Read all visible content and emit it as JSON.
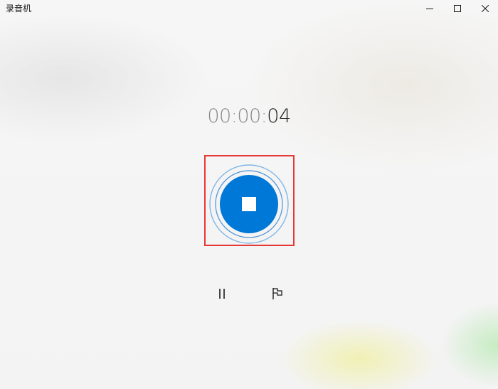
{
  "window": {
    "title": "录音机"
  },
  "titlebar": {
    "minimize_icon": "minimize-icon",
    "maximize_icon": "maximize-icon",
    "close_icon": "close-icon"
  },
  "timer": {
    "hours": "00",
    "sep1": ":",
    "minutes": "00",
    "sep2": ":",
    "seconds": "04"
  },
  "controls": {
    "stop_icon": "stop-icon",
    "pause_icon": "pause-icon",
    "flag_icon": "flag-icon"
  },
  "colors": {
    "accent": "#0078d7",
    "ring": "#7fb6e6",
    "highlight": "#e53935"
  }
}
